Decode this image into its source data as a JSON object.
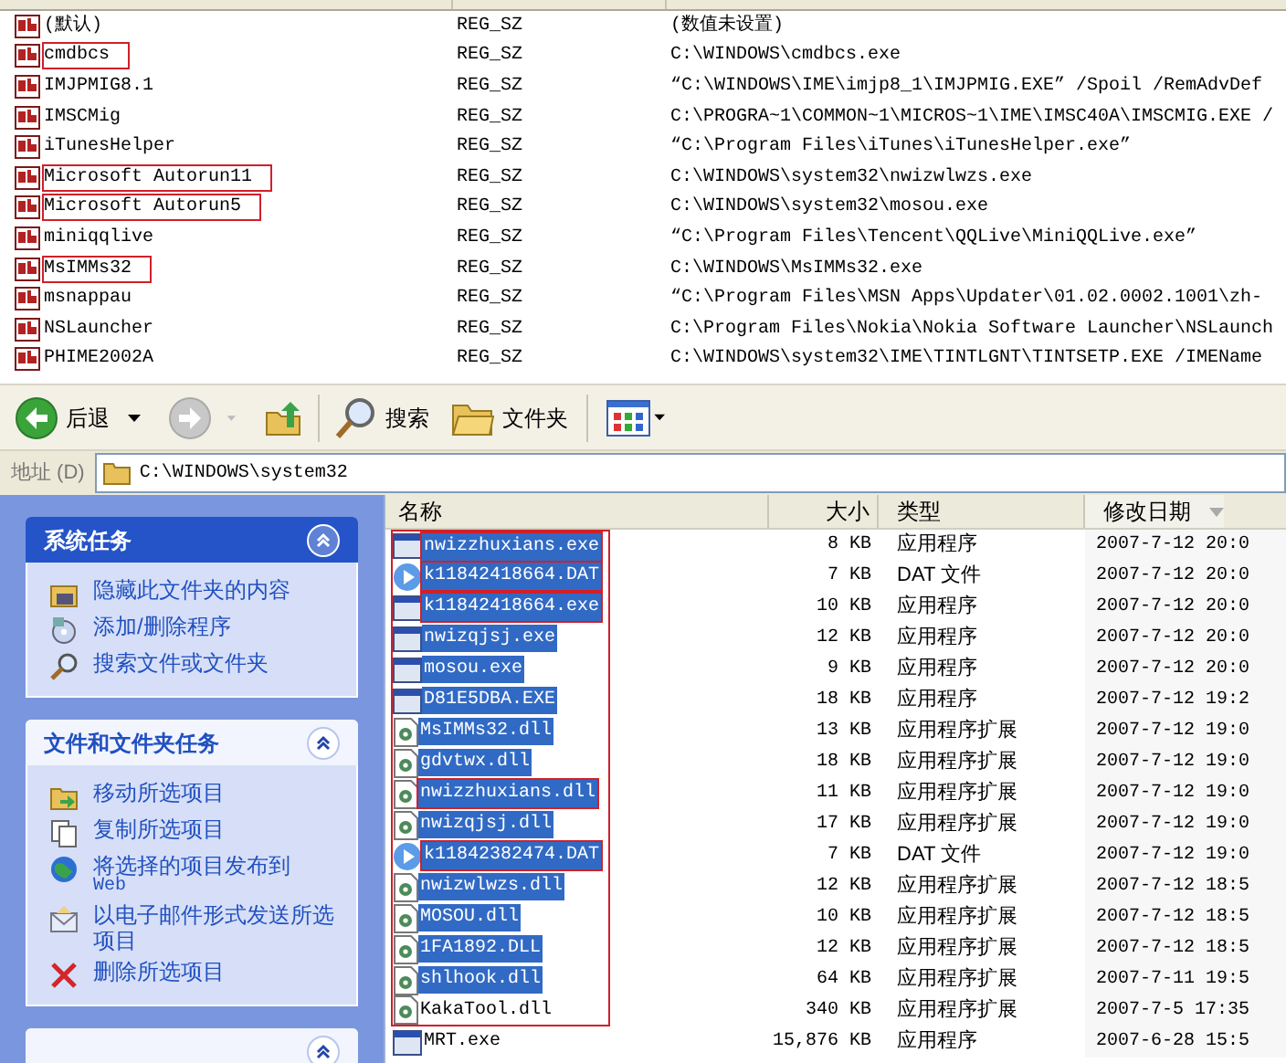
{
  "registry": {
    "rows": [
      {
        "name": "(默认)",
        "type": "REG_SZ",
        "data": "(数值未设置)",
        "highlighted": false
      },
      {
        "name": "cmdbcs",
        "type": "REG_SZ",
        "data": "C:\\WINDOWS\\cmdbcs.exe",
        "highlighted": true
      },
      {
        "name": "IMJPMIG8.1",
        "type": "REG_SZ",
        "data": "“C:\\WINDOWS\\IME\\imjp8_1\\IMJPMIG.EXE” /Spoil /RemAdvDef",
        "highlighted": false
      },
      {
        "name": "IMSCMig",
        "type": "REG_SZ",
        "data": "C:\\PROGRA~1\\COMMON~1\\MICROS~1\\IME\\IMSC40A\\IMSCMIG.EXE /",
        "highlighted": false
      },
      {
        "name": "iTunesHelper",
        "type": "REG_SZ",
        "data": "“C:\\Program Files\\iTunes\\iTunesHelper.exe”",
        "highlighted": false
      },
      {
        "name": "Microsoft Autorun11",
        "type": "REG_SZ",
        "data": "C:\\WINDOWS\\system32\\nwizwlwzs.exe",
        "highlighted": true
      },
      {
        "name": "Microsoft Autorun5",
        "type": "REG_SZ",
        "data": "C:\\WINDOWS\\system32\\mosou.exe",
        "highlighted": true
      },
      {
        "name": "miniqqlive",
        "type": "REG_SZ",
        "data": "“C:\\Program Files\\Tencent\\QQLive\\MiniQQLive.exe”",
        "highlighted": false
      },
      {
        "name": "MsIMMs32",
        "type": "REG_SZ",
        "data": "C:\\WINDOWS\\MsIMMs32.exe",
        "highlighted": true
      },
      {
        "name": "msnappau",
        "type": "REG_SZ",
        "data": "“C:\\Program Files\\MSN Apps\\Updater\\01.02.0002.1001\\zh-",
        "highlighted": false
      },
      {
        "name": "NSLauncher",
        "type": "REG_SZ",
        "data": "C:\\Program Files\\Nokia\\Nokia Software Launcher\\NSLaunch",
        "highlighted": false
      },
      {
        "name": "PHIME2002A",
        "type": "REG_SZ",
        "data": "C:\\WINDOWS\\system32\\IME\\TINTLGNT\\TINTSETP.EXE /IMEName",
        "highlighted": false
      }
    ]
  },
  "toolbar": {
    "back": "后退",
    "search": "搜索",
    "folders": "文件夹"
  },
  "address": {
    "label": "地址 (D)",
    "value": "C:\\WINDOWS\\system32"
  },
  "task_panes": [
    {
      "title": "系统任务",
      "expanded": true,
      "items": [
        {
          "label": "隐藏此文件夹的内容",
          "kind": "folder"
        },
        {
          "label": "添加/删除程序",
          "kind": "disc"
        },
        {
          "label": "搜索文件或文件夹",
          "kind": "search"
        }
      ]
    },
    {
      "title": "文件和文件夹任务",
      "expanded": true,
      "items": [
        {
          "label": "移动所选项目",
          "kind": "move"
        },
        {
          "label": "复制所选项目",
          "kind": "copy"
        },
        {
          "label": "将选择的项目发布到",
          "sub": "Web",
          "kind": "globe"
        },
        {
          "label": "以电子邮件形式发送所选项目",
          "kind": "mail"
        },
        {
          "label": "删除所选项目",
          "kind": "delete"
        }
      ]
    },
    {
      "expanded": true
    }
  ],
  "files": {
    "columns": [
      "名称",
      "大小",
      "类型",
      "修改日期"
    ],
    "rows": [
      {
        "name": "nwizzhuxians.exe",
        "size": "8 KB",
        "type": "应用程序",
        "date": "2007-7-12 20:0",
        "kind": "exe",
        "selected": true,
        "framed": true,
        "boxed": true
      },
      {
        "name": "k11842418664.DAT",
        "size": "7 KB",
        "type": "DAT 文件",
        "date": "2007-7-12 20:0",
        "kind": "dat",
        "selected": true,
        "framed": true,
        "boxed": true
      },
      {
        "name": "k11842418664.exe",
        "size": "10 KB",
        "type": "应用程序",
        "date": "2007-7-12 20:0",
        "kind": "exe",
        "selected": true,
        "framed": true,
        "boxed": true
      },
      {
        "name": "nwizqjsj.exe",
        "size": "12 KB",
        "type": "应用程序",
        "date": "2007-7-12 20:0",
        "kind": "exe",
        "selected": true,
        "framed": true,
        "boxed": false
      },
      {
        "name": "mosou.exe",
        "size": "9 KB",
        "type": "应用程序",
        "date": "2007-7-12 20:0",
        "kind": "exe",
        "selected": true,
        "framed": true,
        "boxed": false
      },
      {
        "name": "D81E5DBA.EXE",
        "size": "18 KB",
        "type": "应用程序",
        "date": "2007-7-12 19:2",
        "kind": "exe",
        "selected": true,
        "framed": true,
        "boxed": false
      },
      {
        "name": "MsIMMs32.dll",
        "size": "13 KB",
        "type": "应用程序扩展",
        "date": "2007-7-12 19:0",
        "kind": "dll",
        "selected": true,
        "framed": true,
        "boxed": false
      },
      {
        "name": "gdvtwx.dll",
        "size": "18 KB",
        "type": "应用程序扩展",
        "date": "2007-7-12 19:0",
        "kind": "dll",
        "selected": true,
        "framed": true,
        "boxed": false
      },
      {
        "name": "nwizzhuxians.dll",
        "size": "11 KB",
        "type": "应用程序扩展",
        "date": "2007-7-12 19:0",
        "kind": "dll",
        "selected": true,
        "framed": true,
        "boxed": true
      },
      {
        "name": "nwizqjsj.dll",
        "size": "17 KB",
        "type": "应用程序扩展",
        "date": "2007-7-12 19:0",
        "kind": "dll",
        "selected": true,
        "framed": true,
        "boxed": false
      },
      {
        "name": "k11842382474.DAT",
        "size": "7 KB",
        "type": "DAT 文件",
        "date": "2007-7-12 19:0",
        "kind": "dat",
        "selected": true,
        "framed": true,
        "boxed": true
      },
      {
        "name": "nwizwlwzs.dll",
        "size": "12 KB",
        "type": "应用程序扩展",
        "date": "2007-7-12 18:5",
        "kind": "dll",
        "selected": true,
        "framed": true,
        "boxed": false
      },
      {
        "name": "MOSOU.dll",
        "size": "10 KB",
        "type": "应用程序扩展",
        "date": "2007-7-12 18:5",
        "kind": "dll",
        "selected": true,
        "framed": true,
        "boxed": false
      },
      {
        "name": "1FA1892.DLL",
        "size": "12 KB",
        "type": "应用程序扩展",
        "date": "2007-7-12 18:5",
        "kind": "dll",
        "selected": true,
        "framed": true,
        "boxed": false
      },
      {
        "name": "shlhook.dll",
        "size": "64 KB",
        "type": "应用程序扩展",
        "date": "2007-7-11 19:5",
        "kind": "dll",
        "selected": true,
        "framed": true,
        "boxed": false
      },
      {
        "name": "KakaTool.dll",
        "size": "340 KB",
        "type": "应用程序扩展",
        "date": "2007-7-5 17:35",
        "kind": "dll",
        "selected": false,
        "framed": true,
        "boxed": false
      },
      {
        "name": "MRT.exe",
        "size": "15,876 KB",
        "type": "应用程序",
        "date": "2007-6-28 15:5",
        "kind": "exe",
        "selected": false,
        "framed": false,
        "boxed": false
      }
    ]
  }
}
